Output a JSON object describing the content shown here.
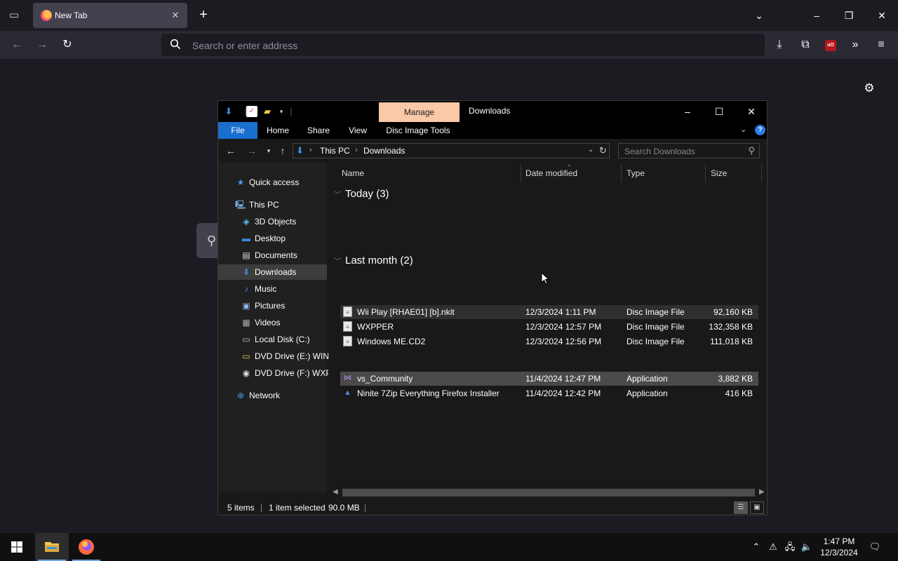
{
  "browser": {
    "tab_title": "New Tab",
    "url_placeholder": "Search or enter address"
  },
  "explorer": {
    "title": "Downloads",
    "manage_label": "Manage",
    "ribbon_tabs": [
      "File",
      "Home",
      "Share",
      "View",
      "Disc Image Tools"
    ],
    "breadcrumb": [
      "This PC",
      "Downloads"
    ],
    "search_placeholder": "Search Downloads",
    "nav": {
      "quick_access": "Quick access",
      "this_pc": "This PC",
      "objects_3d": "3D Objects",
      "desktop": "Desktop",
      "documents": "Documents",
      "downloads": "Downloads",
      "music": "Music",
      "pictures": "Pictures",
      "videos": "Videos",
      "local_disk": "Local Disk (C:)",
      "dvd_e": "DVD Drive (E:) WIND",
      "dvd_f": "DVD Drive (F:) WXPI",
      "network": "Network"
    },
    "columns": {
      "name": "Name",
      "date": "Date modified",
      "type": "Type",
      "size": "Size"
    },
    "groups": [
      {
        "label": "Today (3)",
        "files": [
          {
            "name": "Wii Play [RHAE01] [b].nkit",
            "date": "12/3/2024 1:11 PM",
            "type": "Disc Image File",
            "size": "92,160 KB"
          },
          {
            "name": "WXPPER",
            "date": "12/3/2024 12:57 PM",
            "type": "Disc Image File",
            "size": "132,358 KB"
          },
          {
            "name": "Windows ME.CD2",
            "date": "12/3/2024 12:56 PM",
            "type": "Disc Image File",
            "size": "111,018 KB"
          }
        ]
      },
      {
        "label": "Last month (2)",
        "files": [
          {
            "name": "vs_Community",
            "date": "11/4/2024 12:47 PM",
            "type": "Application",
            "size": "3,882 KB"
          },
          {
            "name": "Ninite 7Zip Everything Firefox Installer",
            "date": "11/4/2024 12:42 PM",
            "type": "Application",
            "size": "416 KB"
          }
        ]
      }
    ],
    "status": {
      "items": "5 items",
      "selected": "1 item selected",
      "size": "90.0 MB"
    }
  },
  "taskbar": {
    "time": "1:47 PM",
    "date": "12/3/2024"
  }
}
